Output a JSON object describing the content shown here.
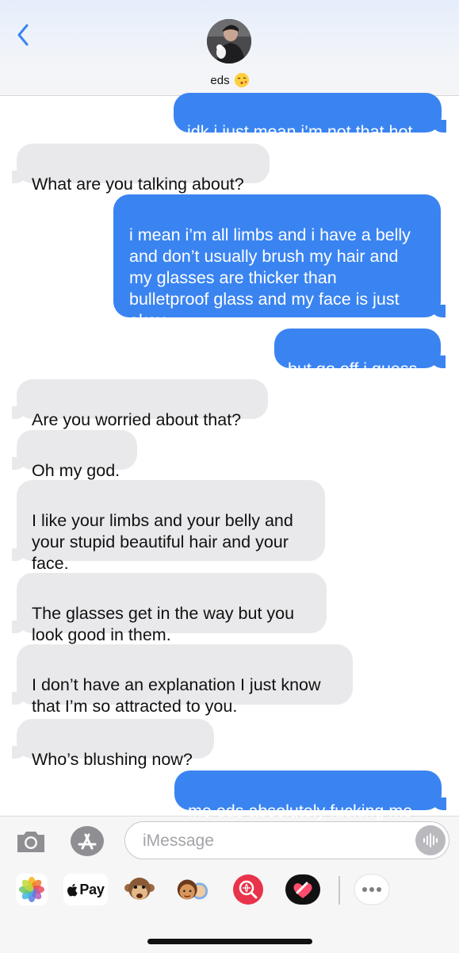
{
  "header": {
    "contact_name": "eds",
    "back_icon": "chevron-left-icon",
    "accent_color": "#3a84f1"
  },
  "messages": [
    {
      "side": "out",
      "text": "idk i just mean i’m not that hot"
    },
    {
      "side": "in",
      "text": "What are you talking about?"
    },
    {
      "side": "out",
      "text": "i mean i’m all limbs and i have a belly\nand don’t usually brush my hair and\nmy glasses are thicker than\nbulletproof glass and my face is just\nokay"
    },
    {
      "side": "out",
      "text": "but go off i guess"
    },
    {
      "side": "in",
      "text": "Are you worried about that?"
    },
    {
      "side": "in",
      "text": "Oh my god."
    },
    {
      "side": "in",
      "text": "I like your limbs and your belly and\nyour stupid beautiful hair and your\nface."
    },
    {
      "side": "in",
      "text": "The glasses get in the way but you\nlook good in them."
    },
    {
      "side": "in",
      "text": "I don’t have an explanation I just know\nthat I’m so attracted to you."
    },
    {
      "side": "in",
      "text": "Who’s blushing now?"
    },
    {
      "side": "out",
      "text": "me eds absolutely fucking me"
    }
  ],
  "input": {
    "placeholder": "iMessage",
    "value": ""
  },
  "app_drawer": {
    "apple_pay_label": "Pay",
    "items": [
      "photos-icon",
      "apple-pay-icon",
      "monkey-animoji-icon",
      "memoji-icon",
      "web-search-icon",
      "digital-touch-icon",
      "more-icon"
    ]
  },
  "colors": {
    "outgoing_bubble": "#3a84f1",
    "incoming_bubble": "#e9e9eb"
  }
}
